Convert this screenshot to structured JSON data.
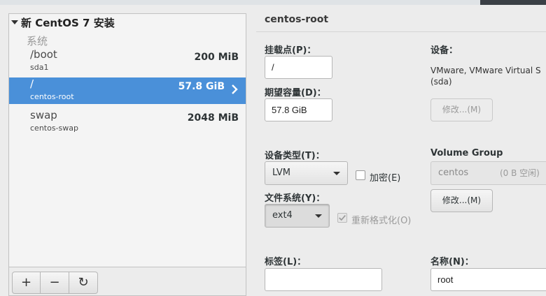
{
  "left_panel": {
    "install_title": "新 CentOS 7 安装",
    "section_label": "系统",
    "mounts": [
      {
        "mount_point": "/boot",
        "device": "sda1",
        "size": "200 MiB"
      },
      {
        "mount_point": "/",
        "device": "centos-root",
        "size": "57.8 GiB"
      },
      {
        "mount_point": "swap",
        "device": "centos-swap",
        "size": "2048 MiB"
      }
    ],
    "toolbar": {
      "add": "+",
      "remove": "−",
      "refresh": "↻"
    }
  },
  "detail": {
    "title": "centos-root",
    "mount_point_label": "挂载点(P)：",
    "mount_point_value": "/",
    "desired_capacity_label": "期望容量(D)：",
    "desired_capacity_value": "57.8 GiB",
    "device_label": "设备：",
    "device_desc_line1": "VMware, VMware Virtual S",
    "device_desc_line2": "(sda)",
    "modify_button": "修改...(M)",
    "device_type_label": "设备类型(T)：",
    "device_type_value": "LVM",
    "encrypt_label": "加密(E)",
    "filesystem_label": "文件系统(Y)：",
    "filesystem_value": "ext4",
    "reformat_label": "重新格式化(O)",
    "volume_group_label": "Volume Group",
    "volume_group_name": "centos",
    "volume_group_free": "(0 B 空闲)",
    "vg_modify_button": "修改...(M)",
    "tag_label": "标签(L)：",
    "tag_value": "",
    "name_label": "名称(N)：",
    "name_value": "root"
  },
  "colors": {
    "selection": "#4a90d9"
  }
}
